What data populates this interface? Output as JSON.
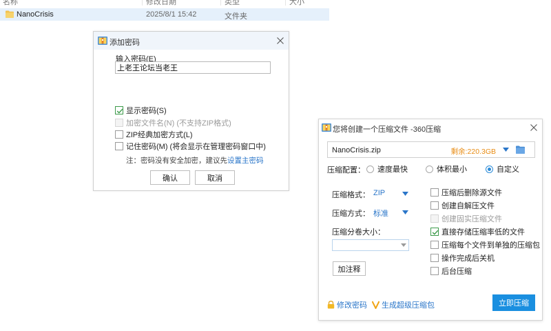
{
  "file_list": {
    "headers": [
      "名称",
      "修改日期",
      "类型",
      "大小"
    ],
    "row": {
      "name": "NanoCrisis",
      "date": "2025/8/1 15:42",
      "type": "文件夹"
    }
  },
  "password_dialog": {
    "title": "添加密码",
    "input_label": "输入密码(E)",
    "password_value": "上老王论坛当老王",
    "options": [
      {
        "label": "显示密码(S)",
        "checked": true,
        "disabled": false
      },
      {
        "label": "加密文件名(N) (不支持ZIP格式)",
        "checked": false,
        "disabled": true
      },
      {
        "label": "ZIP经典加密方式(L)",
        "checked": false,
        "disabled": false
      },
      {
        "label": "记住密码(M) (将会显示在管理密码窗口中)",
        "checked": false,
        "disabled": false
      }
    ],
    "note_prefix": "注：密码没有安全加密，建议先",
    "note_link": "设置主密码",
    "ok_label": "确认",
    "cancel_label": "取消"
  },
  "zip_dialog": {
    "title": "您将创建一个压缩文件 -360压缩",
    "filename": "NanoCrisis.zip",
    "free_space": "剩余:220.3GB",
    "config_label": "压缩配置：",
    "radios": [
      {
        "label": "速度最快",
        "selected": false
      },
      {
        "label": "体积最小",
        "selected": false
      },
      {
        "label": "自定义",
        "selected": true
      }
    ],
    "format_label": "压缩格式：",
    "format_value": "ZIP",
    "method_label": "压缩方式：",
    "method_value": "标准",
    "volume_label": "压缩分卷大小：",
    "volume_value": "",
    "comment_button": "加注释",
    "options": [
      {
        "label": "压缩后删除源文件",
        "checked": false,
        "disabled": false
      },
      {
        "label": "创建自解压文件",
        "checked": false,
        "disabled": false
      },
      {
        "label": "创建固实压缩文件",
        "checked": false,
        "disabled": true
      },
      {
        "label": "直接存储压缩率低的文件",
        "checked": true,
        "disabled": false
      },
      {
        "label": "压缩每个文件到单独的压缩包",
        "checked": false,
        "disabled": false
      },
      {
        "label": "操作完成后关机",
        "checked": false,
        "disabled": false
      },
      {
        "label": "后台压缩",
        "checked": false,
        "disabled": false
      }
    ],
    "change_password_link": "修改密码",
    "super_zip_link": "生成超级压缩包",
    "start_button": "立即压缩"
  },
  "colors": {
    "accent_blue": "#1a8fe0",
    "link_blue": "#2a76c9",
    "free_space_orange": "#e88b12",
    "check_green": "#3c9a4a",
    "row_selected": "#e5f0fb"
  },
  "icons": {
    "folder": "folder-icon",
    "dialog": "zip-app-icon",
    "close": "close-icon",
    "lock": "lock-icon",
    "super_zip": "v-icon",
    "dropdown": "triangle-down-icon"
  }
}
